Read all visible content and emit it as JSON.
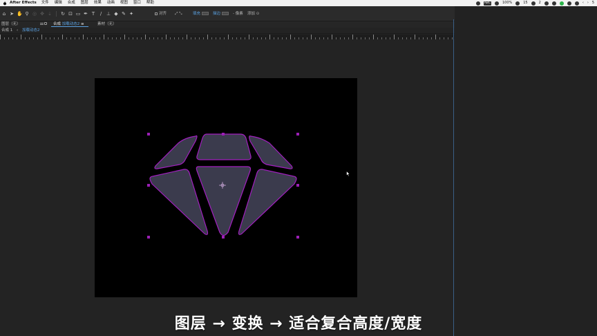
{
  "menubar": {
    "app_name": "After Effects",
    "items": [
      "文件",
      "编辑",
      "合成",
      "图层",
      "效果",
      "动画",
      "视图",
      "窗口",
      "帮助"
    ],
    "status": {
      "battery_pct": "100%",
      "wechat_count": "15",
      "messages_count": "2",
      "extra": "5"
    }
  },
  "toolbar": {
    "snap_label": "对齐",
    "fill_label": "填充",
    "stroke_label": "描边",
    "stroke_width": "- 像素",
    "add_label": "添加"
  },
  "panels": {
    "layer_tab": "图层（无）",
    "comp_tab_prefix": "合成",
    "comp_tab_name": "加载动态2",
    "footage_tab": "素材（无）",
    "breadcrumb_parent": "合成 1",
    "breadcrumb_current": "加载动态2"
  },
  "caption": "图层 → 变换 → 适合复合高度/宽度",
  "colors": {
    "accent_blue": "#5aa0e0",
    "shape_fill": "#3b3b4d",
    "selection_magenta": "#b026c8",
    "canvas_bg": "#000000",
    "app_bg": "#232323"
  }
}
